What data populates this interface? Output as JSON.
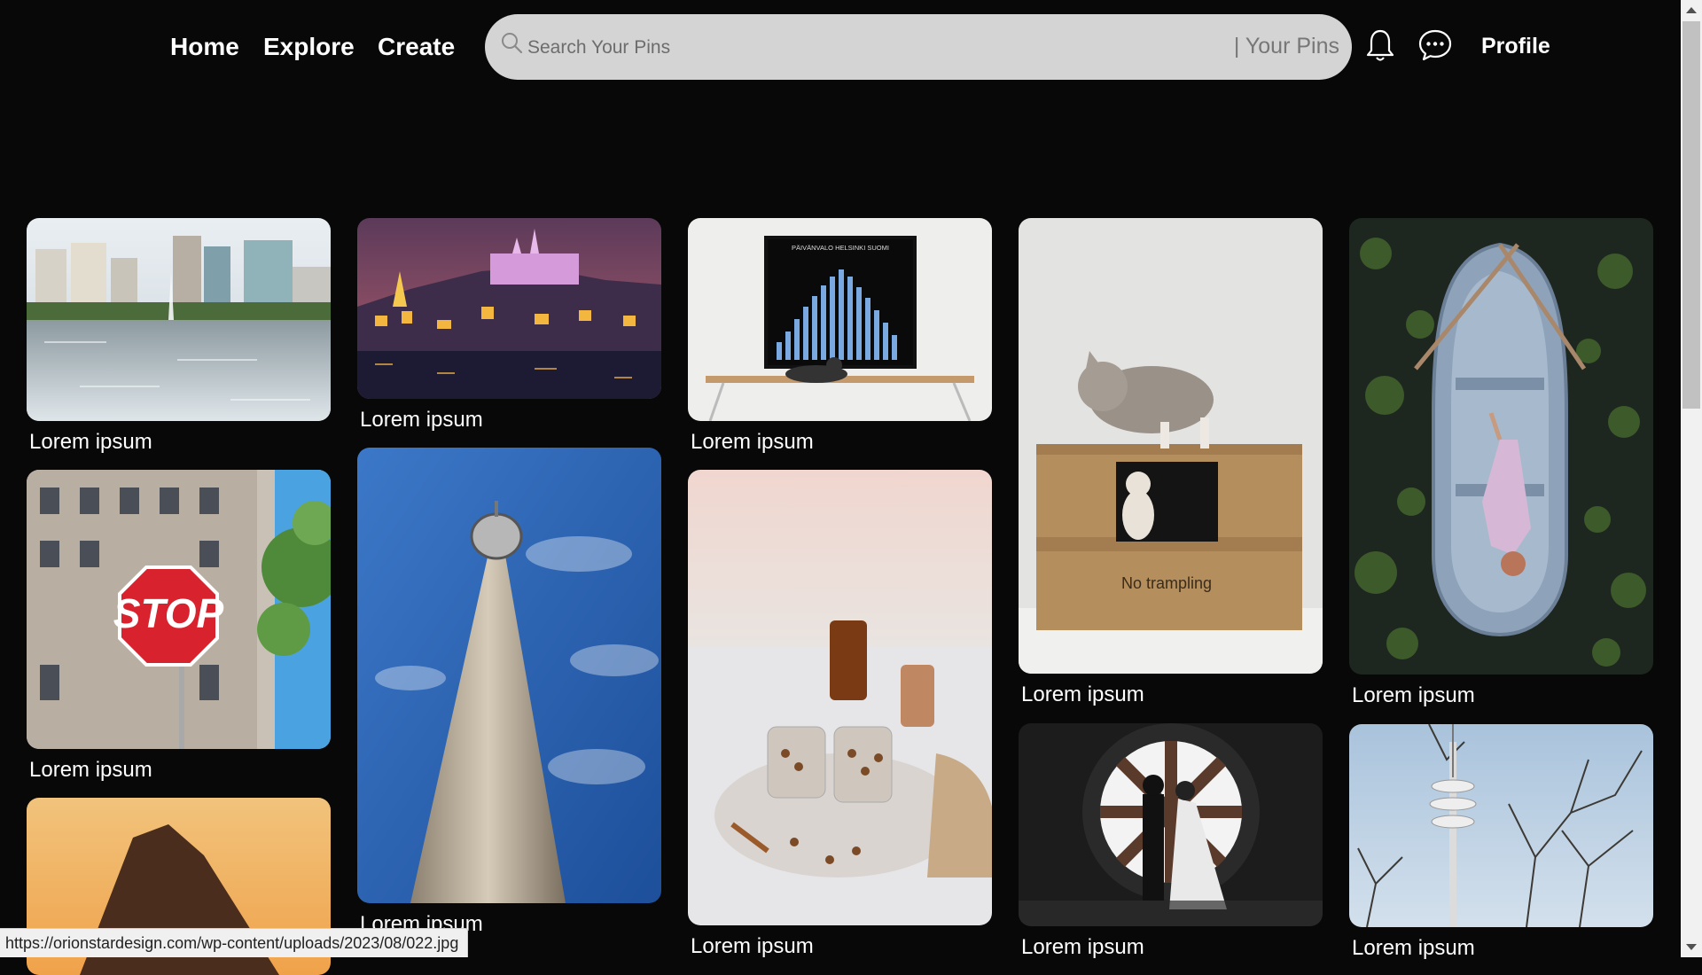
{
  "nav": {
    "home": "Home",
    "explore": "Explore",
    "create": "Create",
    "profile": "Profile"
  },
  "search": {
    "placeholder": "Search Your Pins",
    "scope": "| Your Pins"
  },
  "icons": {
    "search": "search-icon",
    "notifications": "bell-icon",
    "messages": "chat-bubble-icon"
  },
  "pins": [
    {
      "caption": "Lorem ipsum",
      "subject": "city skyline over lake with fountain"
    },
    {
      "caption": "Lorem ipsum",
      "subject": "castle on hill at night above river"
    },
    {
      "caption": "Lorem ipsum",
      "subject": "framed bar chart poster above desk with cat"
    },
    {
      "caption": "Lorem ipsum",
      "subject": "cat on cardboard box"
    },
    {
      "caption": "Lorem ipsum",
      "subject": "woman lying in rowing boat among lily pads"
    },
    {
      "caption": "Lorem ipsum",
      "subject": "stop sign in front of building"
    },
    {
      "caption": "Lorem ipsum",
      "subject": "tall tower against blue sky"
    },
    {
      "caption": "Lorem ipsum",
      "subject": "jars of nuts and spices on table"
    },
    {
      "caption": "Lorem ipsum",
      "subject": "couple silhouetted in round window"
    },
    {
      "caption": "Lorem ipsum",
      "subject": "TV tower behind bare trees"
    },
    {
      "caption": "",
      "subject": "mountain at sunset"
    }
  ],
  "artwork": {
    "poster_title": "PÄIVÄNVALO HELSINKI SUOMI",
    "box_text": "No trampling",
    "sign_text": "STOP"
  },
  "status_bar": {
    "url": "https://orionstardesign.com/wp-content/uploads/2023/08/022.jpg"
  },
  "colors": {
    "background": "#080808",
    "search_bg": "#d4d4d4",
    "text": "#ffffff"
  }
}
